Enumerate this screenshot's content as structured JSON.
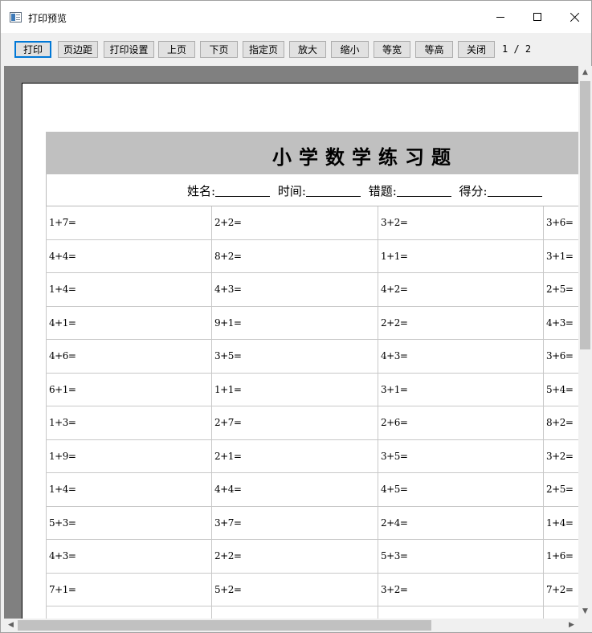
{
  "window": {
    "title": "打印预览"
  },
  "toolbar": {
    "buttons": [
      {
        "label": "打印"
      },
      {
        "label": "页边距"
      },
      {
        "label": "打印设置"
      },
      {
        "label": "上页"
      },
      {
        "label": "下页"
      },
      {
        "label": "指定页"
      },
      {
        "label": "放大"
      },
      {
        "label": "缩小"
      },
      {
        "label": "等宽"
      },
      {
        "label": "等高"
      },
      {
        "label": "关闭"
      }
    ],
    "page_indicator": "1 / 2"
  },
  "sheet": {
    "title": "小学数学练习题",
    "fields": {
      "name_label": "姓名:",
      "time_label": "时间:",
      "errors_label": "错题:",
      "score_label": "得分:"
    },
    "rows": [
      [
        "1+7=",
        "2+2=",
        "3+2=",
        "3+6="
      ],
      [
        "4+4=",
        "8+2=",
        "1+1=",
        "3+1="
      ],
      [
        "1+4=",
        "4+3=",
        "4+2=",
        "2+5="
      ],
      [
        "4+1=",
        "9+1=",
        "2+2=",
        "4+3="
      ],
      [
        "4+6=",
        "3+5=",
        "4+3=",
        "3+6="
      ],
      [
        "6+1=",
        "1+1=",
        "3+1=",
        "5+4="
      ],
      [
        "1+3=",
        "2+7=",
        "2+6=",
        "8+2="
      ],
      [
        "1+9=",
        "2+1=",
        "3+5=",
        "3+2="
      ],
      [
        "1+4=",
        "4+4=",
        "4+5=",
        "2+5="
      ],
      [
        "5+3=",
        "3+7=",
        "2+4=",
        "1+4="
      ],
      [
        "4+3=",
        "2+2=",
        "5+3=",
        "1+6="
      ],
      [
        "7+1=",
        "5+2=",
        "3+2=",
        "7+2="
      ],
      [
        "",
        "",
        "",
        ""
      ]
    ]
  },
  "icons": {
    "app": "print-preview-app-icon",
    "minimize": "minimize-icon",
    "maximize": "maximize-icon",
    "close": "close-icon"
  }
}
